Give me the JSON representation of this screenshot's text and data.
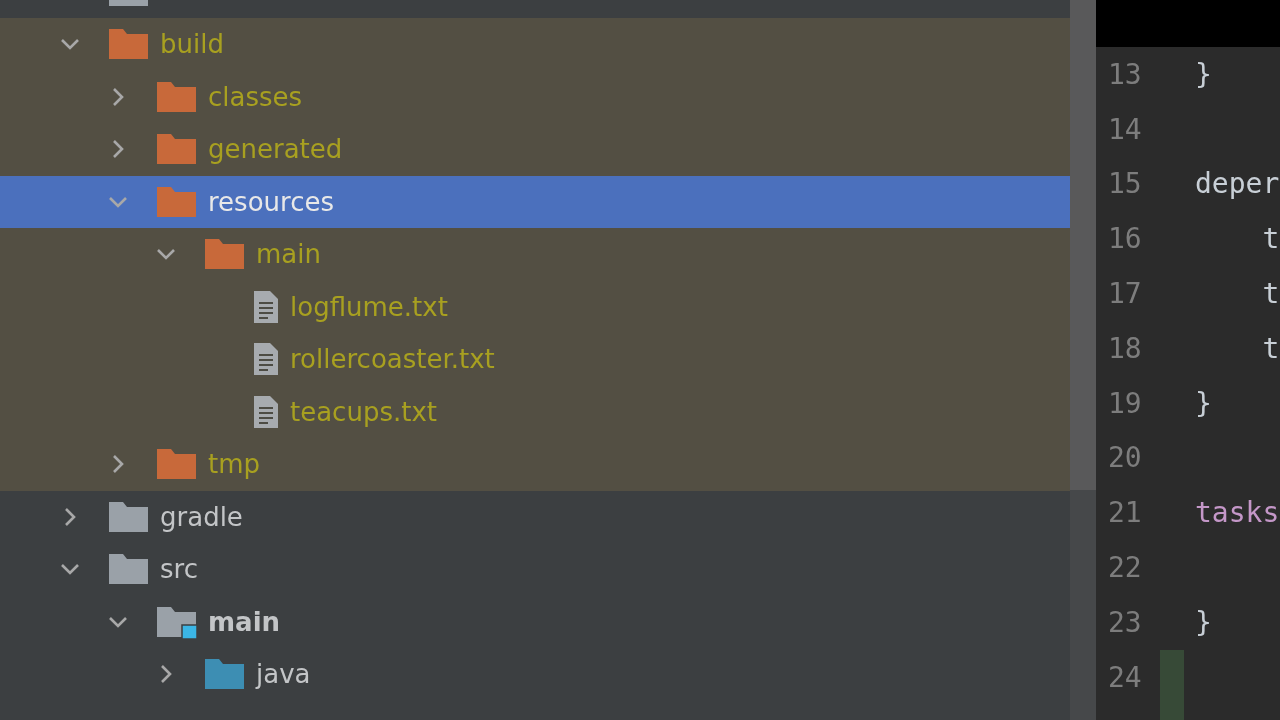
{
  "project_tree": [
    {
      "name": "build",
      "kind": "folder",
      "expanded": true,
      "selected": false,
      "excluded": true,
      "children": [
        {
          "name": "classes",
          "kind": "folder",
          "expanded": false,
          "selected": false
        },
        {
          "name": "generated",
          "kind": "folder",
          "expanded": false,
          "selected": false
        },
        {
          "name": "resources",
          "kind": "folder",
          "expanded": true,
          "selected": true,
          "children": [
            {
              "name": "main",
              "kind": "folder",
              "expanded": true,
              "selected": false,
              "children": [
                {
                  "name": "logflume.txt",
                  "kind": "file",
                  "selected": false
                },
                {
                  "name": "rollercoaster.txt",
                  "kind": "file",
                  "selected": false
                },
                {
                  "name": "teacups.txt",
                  "kind": "file",
                  "selected": false
                }
              ]
            }
          ]
        },
        {
          "name": "tmp",
          "kind": "folder",
          "expanded": false,
          "selected": false
        }
      ]
    },
    {
      "name": "gradle",
      "kind": "folder",
      "expanded": false,
      "selected": false
    },
    {
      "name": "src",
      "kind": "folder",
      "expanded": true,
      "selected": false,
      "children": [
        {
          "name": "main",
          "kind": "source-root",
          "expanded": true,
          "selected": false,
          "children": [
            {
              "name": "java",
              "kind": "source-folder",
              "expanded": false,
              "selected": false
            }
          ]
        }
      ]
    }
  ],
  "editor": {
    "lines": [
      {
        "number": "13",
        "text": "}",
        "kind": "plain"
      },
      {
        "number": "14"
      },
      {
        "number": "15",
        "text": "deper",
        "kind": "plain"
      },
      {
        "number": "16",
        "text": "    t",
        "kind": "plain"
      },
      {
        "number": "17",
        "text": "    t",
        "kind": "plain"
      },
      {
        "number": "18",
        "text": "    t",
        "kind": "plain"
      },
      {
        "number": "19",
        "text": "}",
        "kind": "plain"
      },
      {
        "number": "20"
      },
      {
        "number": "21",
        "text": "tasks",
        "kind": "keyword"
      },
      {
        "number": "22"
      },
      {
        "number": "23",
        "text": "}",
        "kind": "plain"
      },
      {
        "number": "24",
        "added": true
      }
    ]
  }
}
